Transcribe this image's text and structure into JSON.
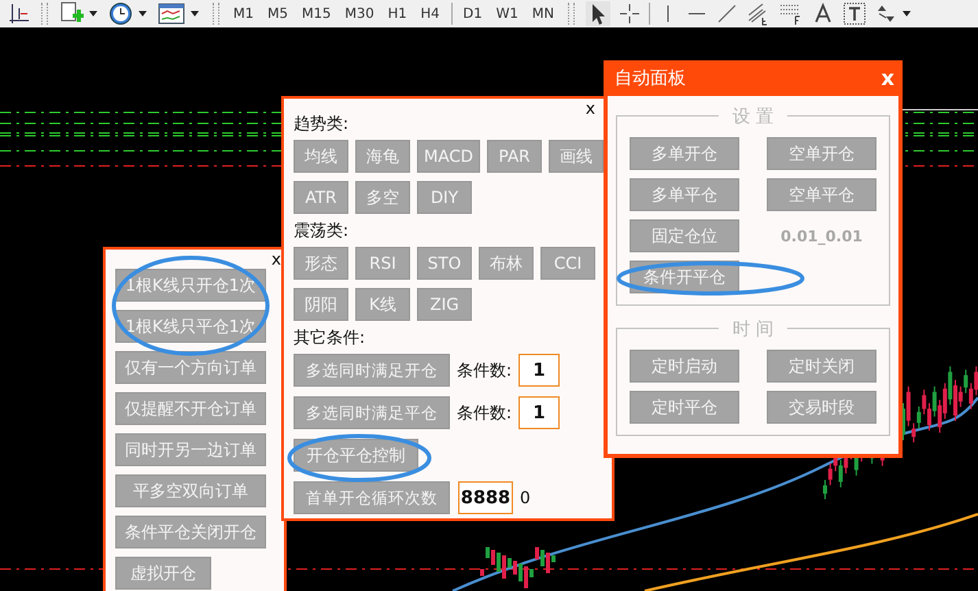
{
  "toolbar": {
    "timeframes": [
      {
        "label": "M1"
      },
      {
        "label": "M5"
      },
      {
        "label": "M15"
      },
      {
        "label": "M30"
      },
      {
        "label": "H1"
      },
      {
        "label": "H4"
      },
      {
        "label": "D1"
      },
      {
        "label": "W1"
      },
      {
        "label": "MN"
      }
    ]
  },
  "left_panel": {
    "close": "x",
    "buttons": [
      "1根K线只开仓1次",
      "1根K线只平仓1次",
      "仅有一个方向订单",
      "仅提醒不开仓订单",
      "同时开另一边订单",
      "平多空双向订单",
      "条件平仓关闭开仓",
      "虚拟开仓"
    ]
  },
  "middle_panel": {
    "close": "x",
    "sections": [
      {
        "title": "趋势类:",
        "buttons": [
          "均线",
          "海龟",
          "MACD",
          "PAR",
          "画线",
          "ATR",
          "多空",
          "DIY"
        ]
      },
      {
        "title": "震荡类:",
        "buttons": [
          "形态",
          "RSI",
          "STO",
          "布林",
          "CCI",
          "阴阳",
          "K线",
          "ZIG"
        ]
      }
    ],
    "other": {
      "title": "其它条件:",
      "rows": [
        {
          "kind": "count",
          "button": "多选同时满足开仓",
          "label": "条件数:",
          "value": "1"
        },
        {
          "kind": "count",
          "button": "多选同时满足平仓",
          "label": "条件数:",
          "value": "1"
        },
        {
          "kind": "button",
          "button": "开仓平仓控制"
        },
        {
          "kind": "loop",
          "button": "首单开仓循环次数",
          "value": "8888",
          "extra": "0"
        }
      ]
    }
  },
  "right_panel": {
    "title": "自动面板",
    "close": "x",
    "groups": [
      {
        "legend": "设 置",
        "items": [
          {
            "kind": "button",
            "label": "多单开仓"
          },
          {
            "kind": "button",
            "label": "空单开仓"
          },
          {
            "kind": "button",
            "label": "多单平仓"
          },
          {
            "kind": "button",
            "label": "空单平仓"
          },
          {
            "kind": "button",
            "label": "固定仓位"
          },
          {
            "kind": "text",
            "label": "0.01_0.01"
          },
          {
            "kind": "button",
            "label": "条件开平仓"
          }
        ]
      },
      {
        "legend": "时 间",
        "items": [
          {
            "kind": "button",
            "label": "定时启动"
          },
          {
            "kind": "button",
            "label": "定时关闭"
          },
          {
            "kind": "button",
            "label": "定时平仓"
          },
          {
            "kind": "button",
            "label": "交易时段"
          }
        ]
      }
    ]
  }
}
